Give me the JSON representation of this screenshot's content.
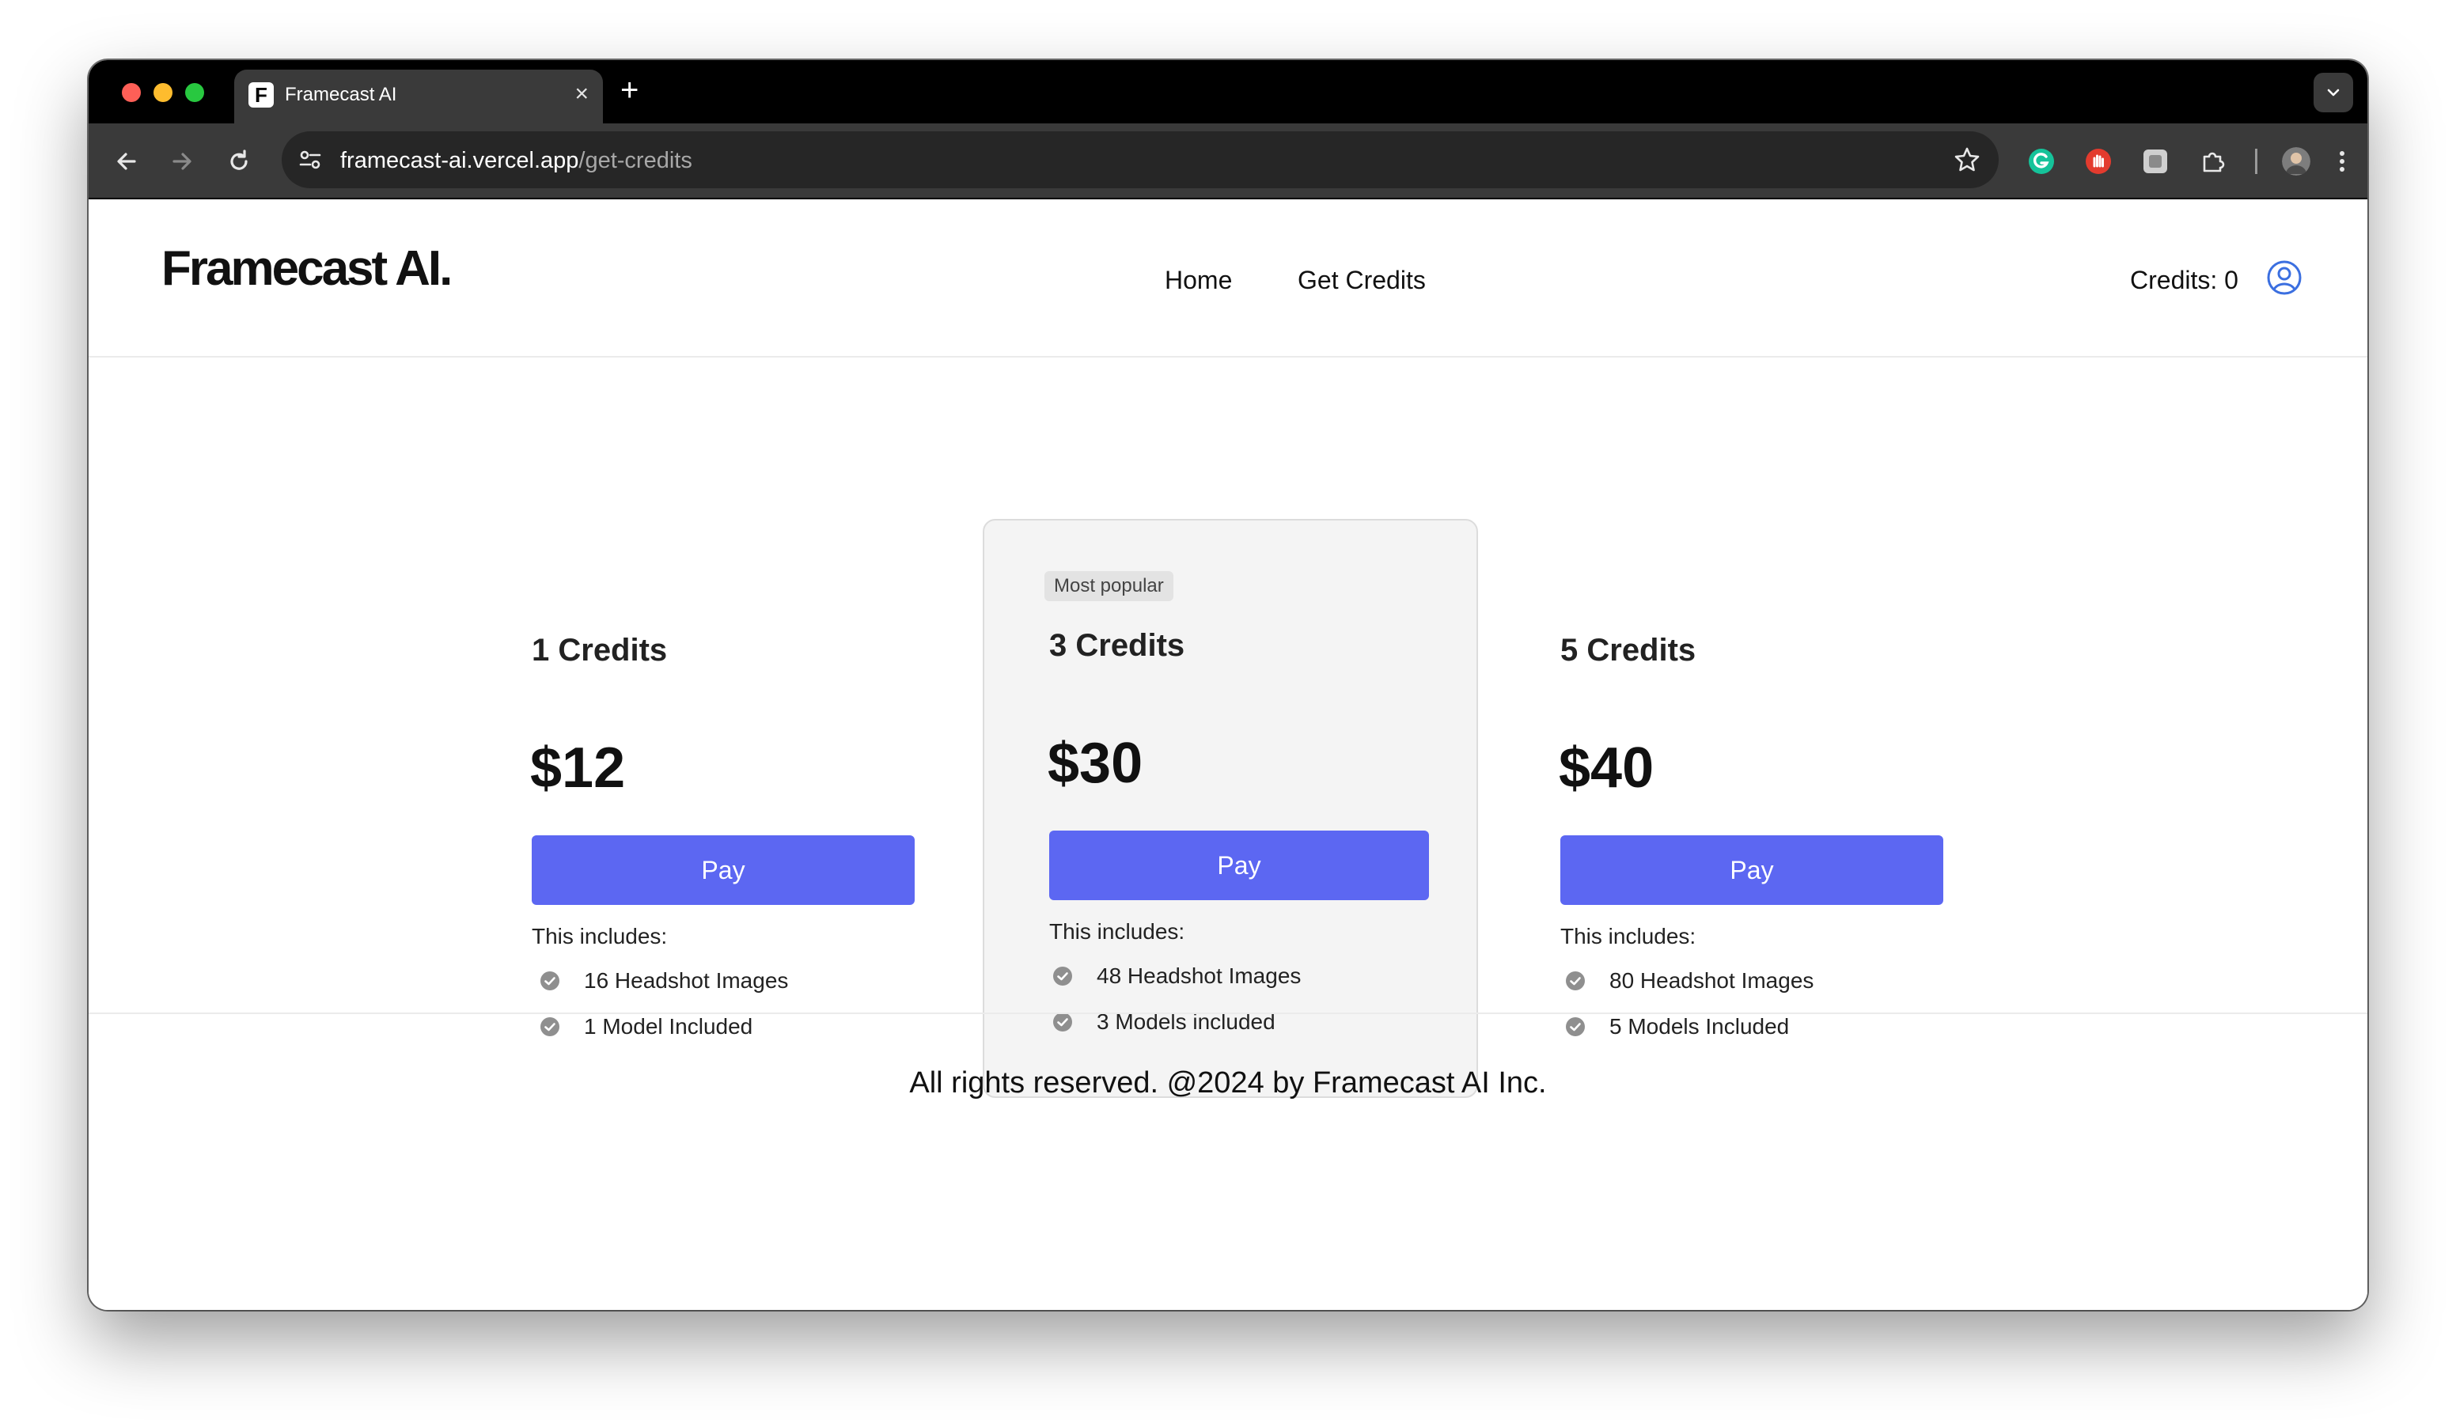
{
  "browser": {
    "tab_title": "Framecast AI",
    "tab_favicon_letter": "F",
    "tab_close": "×",
    "new_tab": "+",
    "url_host": "framecast-ai.vercel.app",
    "url_path": "/get-credits"
  },
  "header": {
    "logo": "Framecast AI.",
    "nav": [
      {
        "label": "Home"
      },
      {
        "label": "Get Credits"
      }
    ],
    "credits": "Credits: 0"
  },
  "plans": [
    {
      "title": "1 Credits",
      "price": "$12",
      "pay_label": "Pay",
      "includes_label": "This includes:",
      "features": [
        "16 Headshot Images",
        "1 Model Included"
      ]
    },
    {
      "badge": "Most popular",
      "title": "3 Credits",
      "price": "$30",
      "pay_label": "Pay",
      "includes_label": "This includes:",
      "features": [
        "48 Headshot Images",
        "3 Models included"
      ]
    },
    {
      "title": "5 Credits",
      "price": "$40",
      "pay_label": "Pay",
      "includes_label": "This includes:",
      "features": [
        "80 Headshot Images",
        "5 Models Included"
      ]
    }
  ],
  "footer": {
    "text": "All rights reserved. @2024 by Framecast AI Inc."
  },
  "colors": {
    "accent": "#5c67f2",
    "user_icon": "#3b6fe0"
  },
  "icons": [
    "back-arrow-icon",
    "forward-arrow-icon",
    "reload-icon",
    "site-settings-icon",
    "bookmark-star-icon",
    "grammarly-icon",
    "adblock-icon",
    "extension-icon",
    "puzzle-icon",
    "profile-avatar-icon",
    "kebab-menu-icon",
    "user-circle-icon",
    "check-circle-icon"
  ]
}
